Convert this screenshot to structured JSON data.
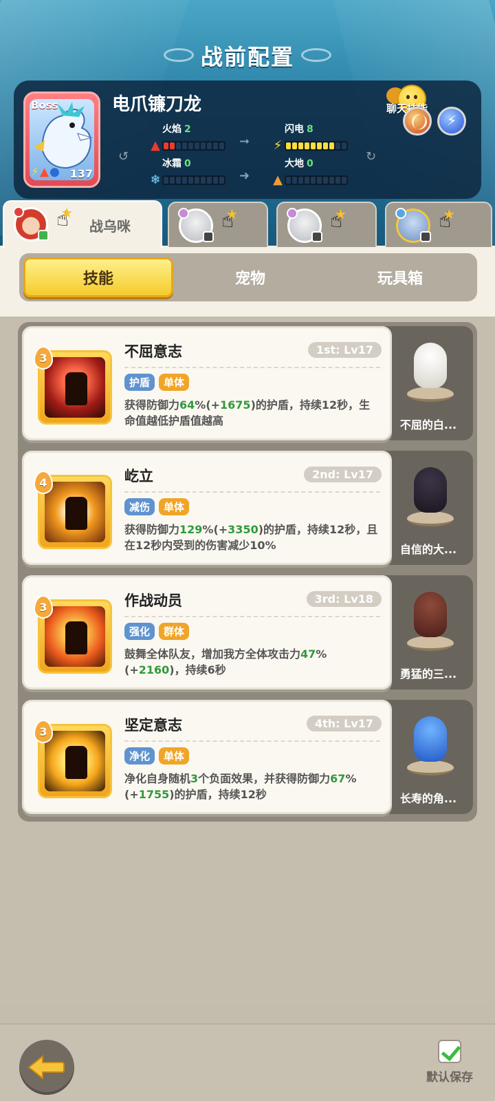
{
  "header": {
    "title": "战前配置"
  },
  "boss": {
    "tag": "Boss",
    "name": "电爪镰刀龙",
    "level": "137",
    "chat_skill_label": "聊天技能",
    "stats": [
      {
        "label": "火焰",
        "value": "2",
        "filled": 2,
        "icon": "fire-icon",
        "color": "#ec3b2d"
      },
      {
        "label": "闪电",
        "value": "8",
        "filled": 8,
        "icon": "lightning-icon",
        "color": "#ffdd3a"
      },
      {
        "label": "冰霜",
        "value": "0",
        "filled": 0,
        "icon": "snowflake-icon",
        "color": "#7fd6ff"
      },
      {
        "label": "大地",
        "value": "0",
        "filled": 0,
        "icon": "mountain-icon",
        "color": "#f09b3a"
      }
    ]
  },
  "characters": [
    {
      "name": "战乌咪",
      "active": true
    },
    {
      "name": "",
      "active": false
    },
    {
      "name": "",
      "active": false
    },
    {
      "name": "",
      "active": false
    }
  ],
  "tabs": [
    {
      "label": "技能",
      "active": true
    },
    {
      "label": "宠物",
      "active": false
    },
    {
      "label": "玩具箱",
      "active": false
    }
  ],
  "skills": [
    {
      "cost": "3",
      "name": "不屈意志",
      "order": "1st: Lv17",
      "tags": [
        "护盾",
        "单体"
      ],
      "desc": [
        {
          "t": "获得防御力"
        },
        {
          "t": "64",
          "g": true
        },
        {
          "t": "%(+"
        },
        {
          "t": "1675",
          "g": true
        },
        {
          "t": ")的护盾，持续12秒，生命值越低护盾值越高"
        }
      ],
      "pet_name": "不屈的白..."
    },
    {
      "cost": "4",
      "name": "屹立",
      "order": "2nd: Lv17",
      "tags": [
        "减伤",
        "单体"
      ],
      "desc": [
        {
          "t": "获得防御力"
        },
        {
          "t": "129",
          "g": true
        },
        {
          "t": "%(+"
        },
        {
          "t": "3350",
          "g": true
        },
        {
          "t": ")的护盾，持续12秒，且在12秒内受到的伤害减少10%"
        }
      ],
      "pet_name": "自信的大..."
    },
    {
      "cost": "3",
      "name": "作战动员",
      "order": "3rd: Lv18",
      "tags": [
        "强化",
        "群体"
      ],
      "desc": [
        {
          "t": "鼓舞全体队友，增加我方全体攻击力"
        },
        {
          "t": "47",
          "g": true
        },
        {
          "t": "%(+"
        },
        {
          "t": "2160",
          "g": true
        },
        {
          "t": ")，持续6秒"
        }
      ],
      "pet_name": "勇猛的三..."
    },
    {
      "cost": "3",
      "name": "坚定意志",
      "order": "4th: Lv17",
      "tags": [
        "净化",
        "单体"
      ],
      "desc": [
        {
          "t": "净化自身随机"
        },
        {
          "t": "3",
          "g": true
        },
        {
          "t": "个负面效果，并获得防御力"
        },
        {
          "t": "67",
          "g": true
        },
        {
          "t": "%(+"
        },
        {
          "t": "1755",
          "g": true
        },
        {
          "t": ")的护盾，持续12秒"
        }
      ],
      "pet_name": "长寿的角..."
    }
  ],
  "footer": {
    "save_label": "默认保存"
  }
}
